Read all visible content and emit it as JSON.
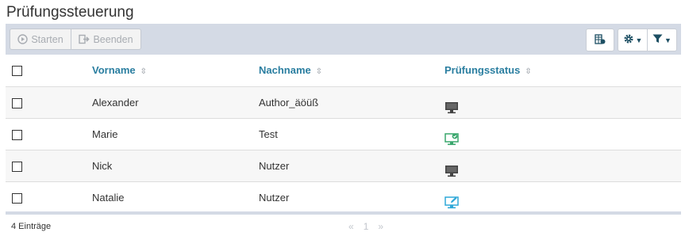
{
  "page": {
    "title": "Prüfungssteuerung"
  },
  "toolbar": {
    "start_label": "Starten",
    "end_label": "Beenden",
    "icons": {
      "start": "play-circle-icon",
      "end": "sign-out-icon",
      "columns": "columns-icon",
      "settings": "gear-icon",
      "filter": "filter-icon"
    }
  },
  "table": {
    "columns": {
      "first": "Vorname",
      "last": "Nachname",
      "status": "Prüfungsstatus"
    },
    "rows": [
      {
        "first": "Alexander",
        "last": "Author_äöüß",
        "status_icon": "monitor-icon"
      },
      {
        "first": "Marie",
        "last": "Test",
        "status_icon": "monitor-check-icon"
      },
      {
        "first": "Nick",
        "last": "Nutzer",
        "status_icon": "monitor-icon"
      },
      {
        "first": "Natalie",
        "last": "Nutzer",
        "status_icon": "monitor-edit-icon"
      }
    ]
  },
  "footer": {
    "count": "4 Einträge",
    "pager": {
      "prev": "«",
      "page": "1",
      "next": "»"
    }
  },
  "colors": {
    "header_link": "#2a7ea0",
    "toolbar_bg": "#d4dae5",
    "status_ok": "#3aa76d",
    "status_edit": "#2fa8d8",
    "status_idle": "#444444"
  }
}
